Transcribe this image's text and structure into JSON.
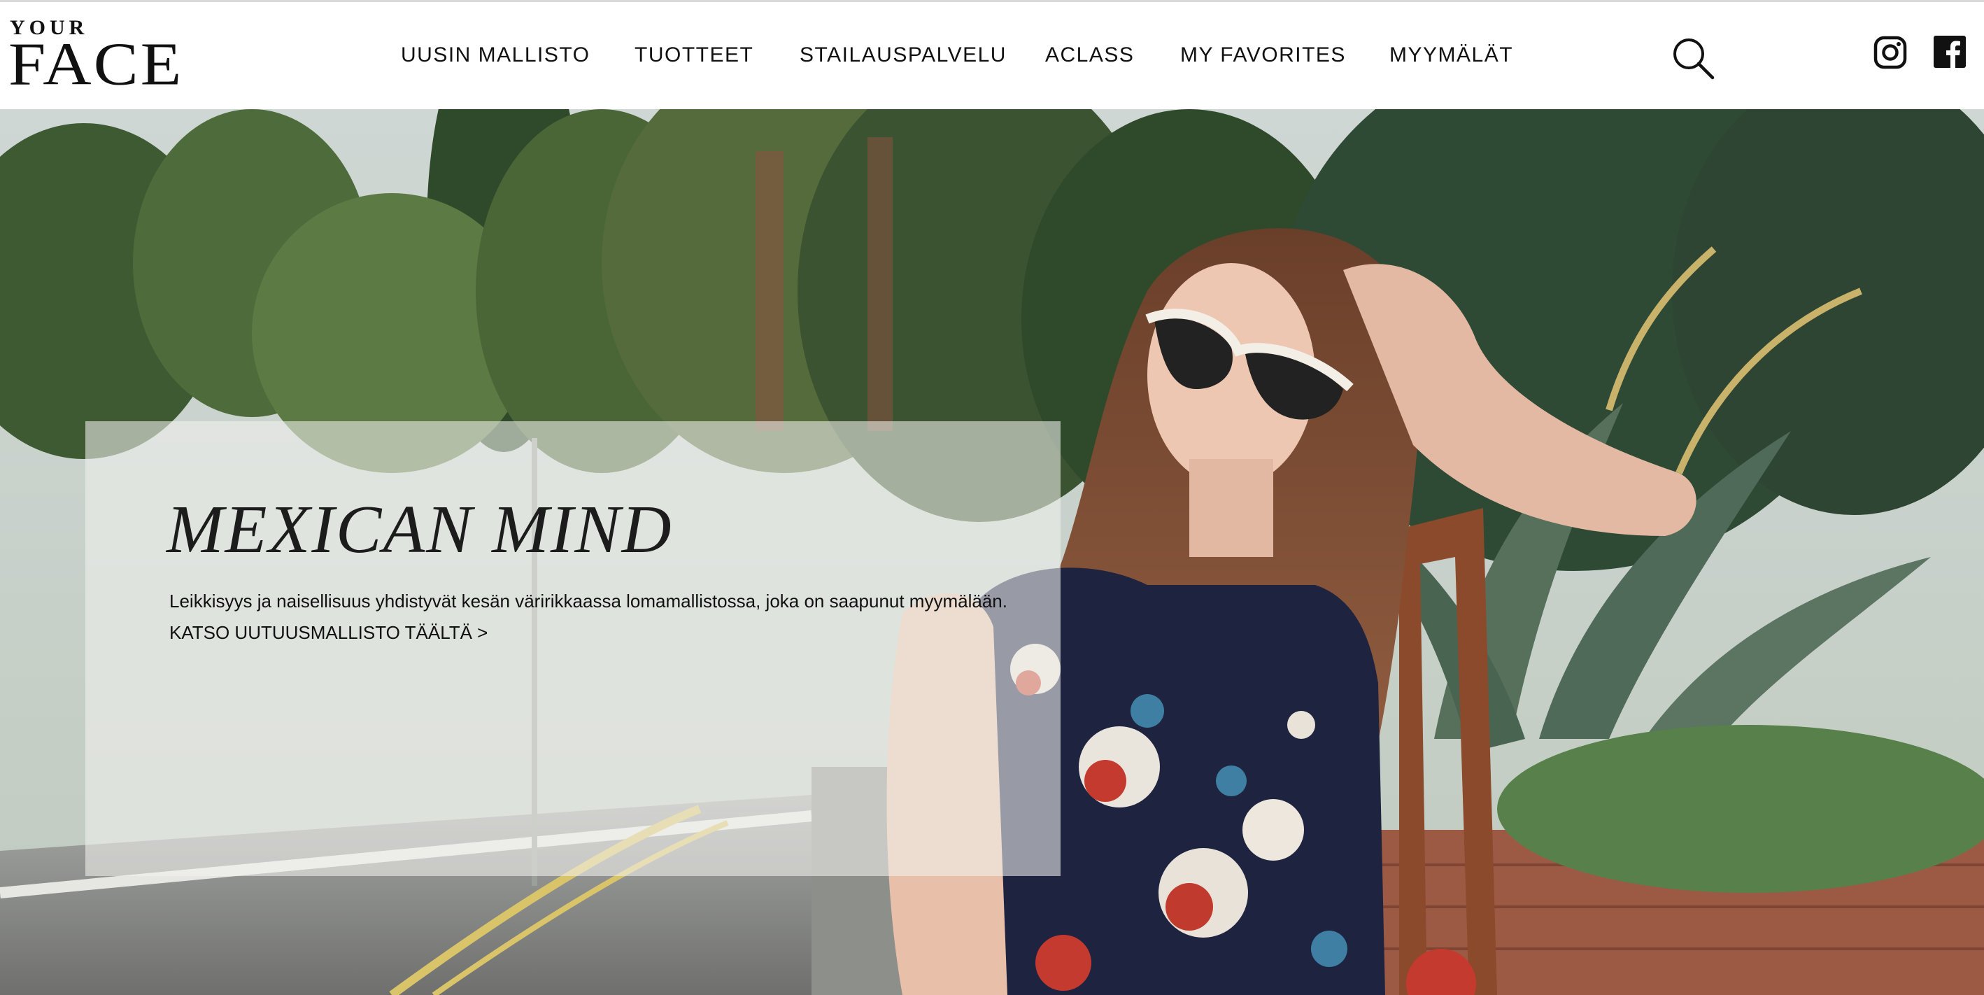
{
  "brand": {
    "small": "YOUR",
    "big": "FACE"
  },
  "nav": {
    "items": [
      {
        "label": "UUSIN MALLISTO"
      },
      {
        "label": "TUOTTEET"
      },
      {
        "label": "STAILAUSPALVELU"
      },
      {
        "label": "ACLASS"
      },
      {
        "label": "MY FAVORITES"
      },
      {
        "label": "MYYMÄLÄT"
      }
    ]
  },
  "icons": {
    "search": "search-icon",
    "instagram": "instagram-icon",
    "facebook": "facebook-icon"
  },
  "hero": {
    "headline": "MEXICAN MIND",
    "body": "Leikkisyys ja naisellisuus yhdistyvät kesän väririkkaassa lomamallistossa, joka on saapunut myymälään.",
    "link": "KATSO UUTUUSMALLISTO TÄÄLTÄ >"
  },
  "colors": {
    "text": "#111111",
    "header_bg": "#ffffff",
    "panel": "#f2f2ee"
  }
}
